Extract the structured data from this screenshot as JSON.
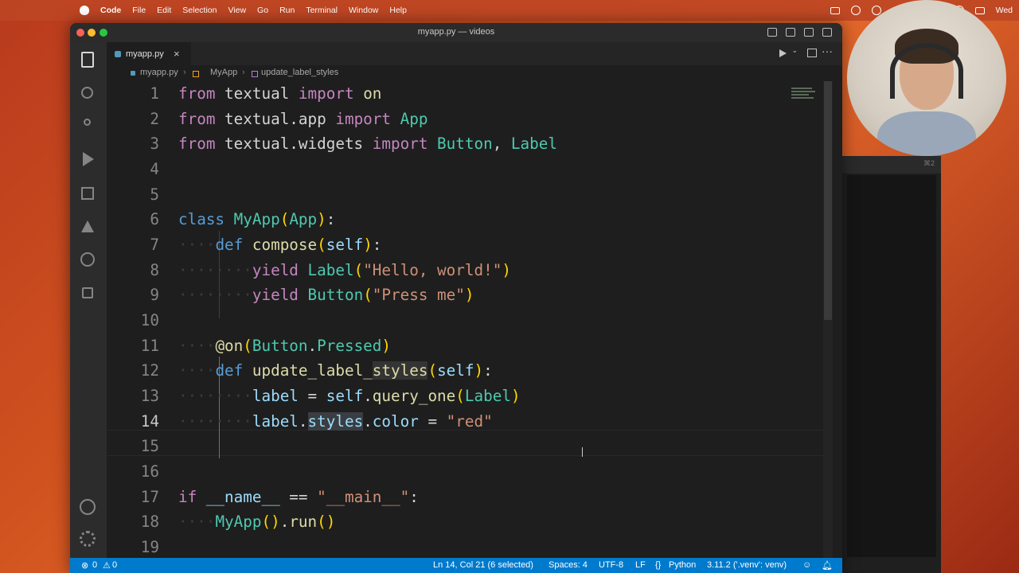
{
  "menubar": {
    "app": "Code",
    "items": [
      "File",
      "Edit",
      "Selection",
      "View",
      "Go",
      "Run",
      "Terminal",
      "Window",
      "Help"
    ],
    "clock": "Wed"
  },
  "window": {
    "title": "myapp.py — videos"
  },
  "tab": {
    "filename": "myapp.py",
    "close": "×"
  },
  "breadcrumbs": {
    "file": "myapp.py",
    "class": "MyApp",
    "method": "update_label_styles",
    "sep": "›"
  },
  "editor": {
    "line_numbers": [
      "1",
      "2",
      "3",
      "4",
      "5",
      "6",
      "7",
      "8",
      "9",
      "10",
      "11",
      "12",
      "13",
      "14",
      "15",
      "16",
      "17",
      "18",
      "19"
    ],
    "current_line": "14"
  },
  "status": {
    "errors": "0",
    "warnings": "0",
    "position": "Ln 14, Col 21 (6 selected)",
    "spaces": "Spaces: 4",
    "encoding": "UTF-8",
    "eol": "LF",
    "language": "Python",
    "interpreter": "3.11.2 ('.venv': venv)"
  },
  "side_panel": {
    "shortcut": "⌘2"
  },
  "colors": {
    "statusbar": "#007acc",
    "editor_bg": "#1e1e1e",
    "keyword": "#c586c0",
    "class": "#4ec9b0",
    "function": "#dcdcaa",
    "string": "#ce9178"
  }
}
